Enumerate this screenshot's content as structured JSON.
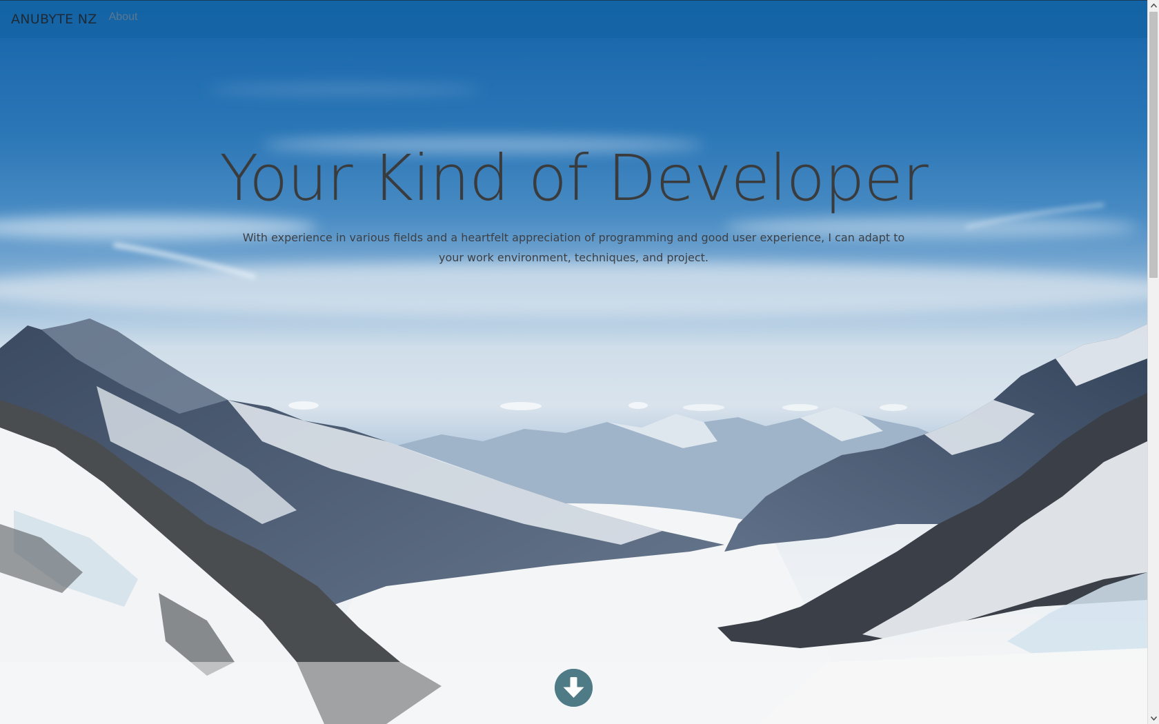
{
  "navbar": {
    "brand": "ANUBYTE NZ",
    "links": [
      {
        "label": "About"
      }
    ]
  },
  "hero": {
    "title": "Your Kind of Developer",
    "subtitle": "With experience in various fields and a heartfelt appreciation of programming and good user experience, I can adapt to your work environment, techniques, and project.",
    "scroll_button_icon": "arrow-circle-down-icon",
    "background_image": "snowy-mountain-glacier-valley-photo"
  },
  "colors": {
    "navbar_bg": "#1464a5",
    "sky_top": "#1a64a8",
    "headline": "#3a3b3d",
    "button": "#4e7b86"
  },
  "scrollbar": {
    "up_icon": "chevron-up-icon",
    "down_icon": "chevron-down-icon"
  }
}
